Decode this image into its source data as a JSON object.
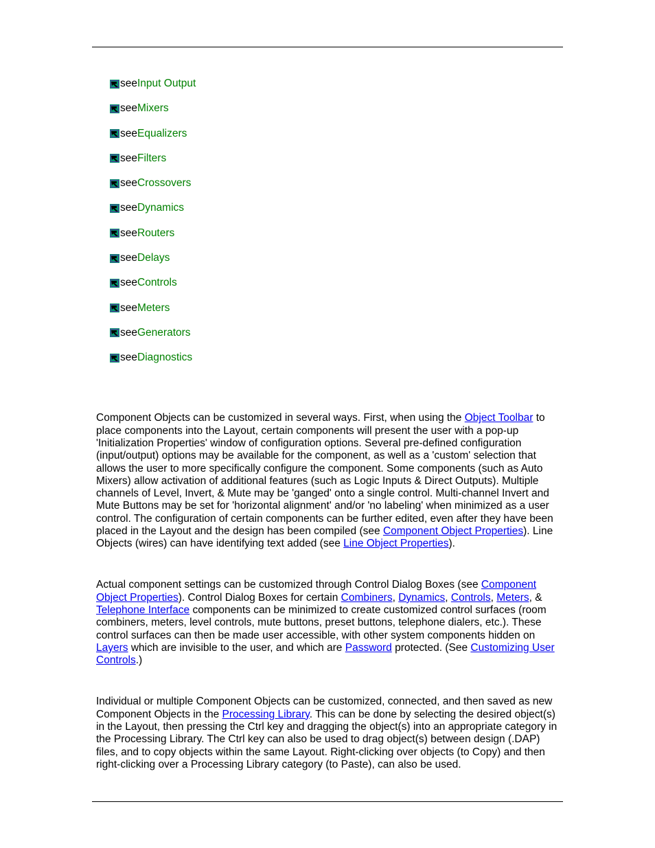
{
  "see_items": [
    {
      "prefix": "see ",
      "link": "Input Output"
    },
    {
      "prefix": "see ",
      "link": "Mixers"
    },
    {
      "prefix": "see ",
      "link": "Equalizers"
    },
    {
      "prefix": "see ",
      "link": "Filters"
    },
    {
      "prefix": "see ",
      "link": "Crossovers"
    },
    {
      "prefix": "see ",
      "link": "Dynamics"
    },
    {
      "prefix": "see ",
      "link": "Routers"
    },
    {
      "prefix": "see ",
      "link": "Delays"
    },
    {
      "prefix": "see ",
      "link": "Controls"
    },
    {
      "prefix": "see ",
      "link": "Meters"
    },
    {
      "prefix": "see ",
      "link": "Generators"
    },
    {
      "prefix": "see ",
      "link": "Diagnostics"
    }
  ],
  "p1": {
    "t0": "Component Objects can be customized in several ways. First, when using the ",
    "l0": "Object Toolbar",
    "t1": " to place components into the Layout, certain components will present the user with a pop-up 'Initialization Properties' window of configuration options. Several pre-defined configuration (input/output) options may be available for the component, as well as a 'custom' selection that allows the user to more specifically configure the component. Some components (such as Auto Mixers) allow activation of additional features (such as Logic Inputs & Direct Outputs). Multiple channels of Level, Invert, & Mute may be 'ganged' onto a single control. Multi-channel Invert and Mute Buttons may be set for 'horizontal alignment' and/or 'no labeling' when minimized as a user control. The configuration of certain components can be further edited, even after they have been placed in the Layout and the design has been compiled (see ",
    "l1": "Component Object Properties",
    "t2": "). Line Objects (wires) can have identifying text added (see ",
    "l2": "Line Object Properties",
    "t3": ")."
  },
  "p2": {
    "t0": "Actual component settings can be customized through Control Dialog Boxes (see ",
    "l0": "Component Object Properties",
    "t1": "). Control Dialog Boxes for certain ",
    "l1": "Combiners",
    "t2": ", ",
    "l2": "Dynamics",
    "t3": ", ",
    "l3": "Controls",
    "t4": ", ",
    "l4": "Meters",
    "t5": ", & ",
    "l5": "Telephone Interface",
    "t6": " components can be minimized to create customized control surfaces (room combiners, meters, level controls, mute buttons, preset buttons, telephone dialers, etc.). These control surfaces can then be made user accessible, with other system components hidden on ",
    "l6": "Layers",
    "t7": " which are invisible to the user, and which are ",
    "l7": "Password",
    "t8": " protected. (See ",
    "l8": "Customizing User Controls",
    "t9": ".)"
  },
  "p3": {
    "t0": "Individual or multiple Component Objects can be customized, connected, and then saved as new Component Objects in the ",
    "l0": "Processing Library",
    "t1": ". This can be done by selecting the desired object(s) in the Layout, then pressing the ",
    "k0": "Ctrl",
    "t2": " key and dragging the object(s) into an appropriate category in the Processing Library. The ",
    "k1": "Ctrl",
    "t3": " key can also be used to drag object(s) between design (.DAP) files, and to copy objects within the same Layout. Right-clicking over objects (to Copy) and then right-clicking over a Processing Library category (to Paste), can also be used."
  }
}
